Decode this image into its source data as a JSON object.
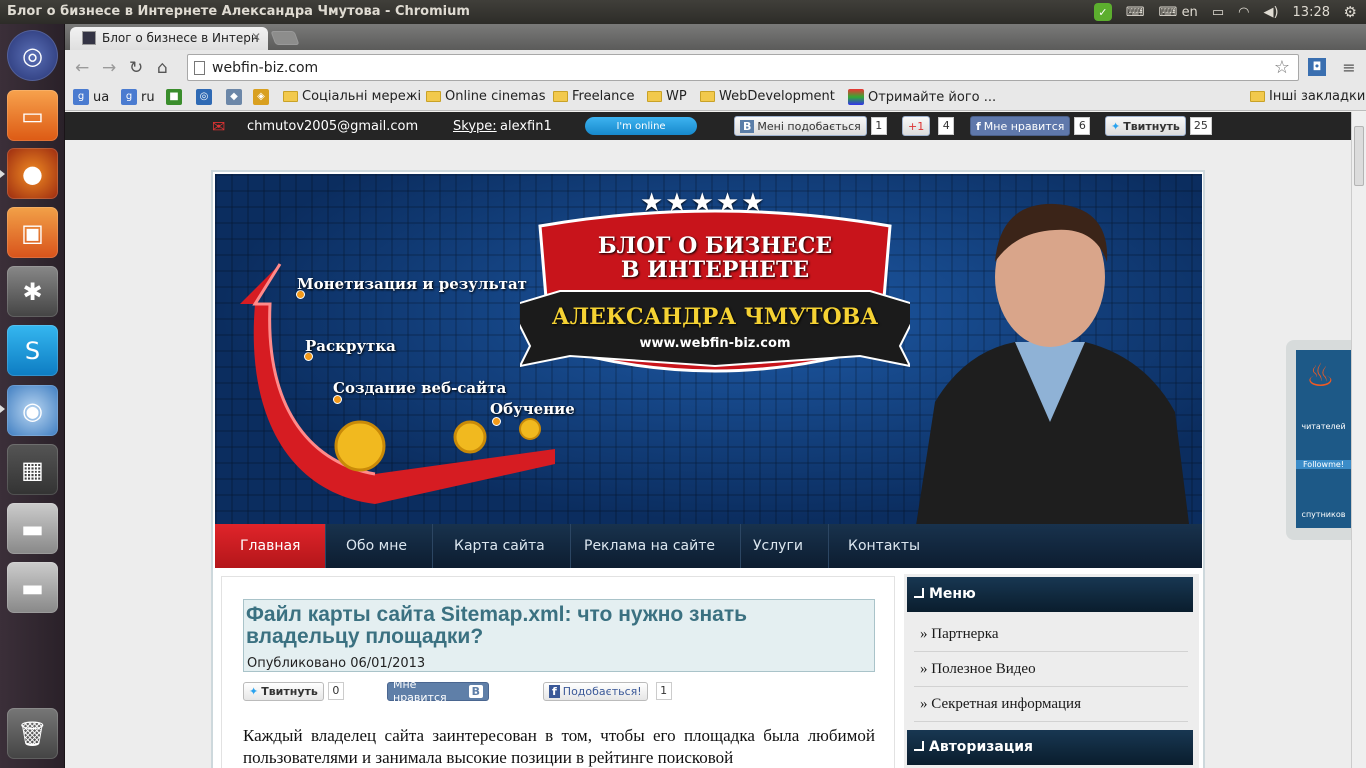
{
  "window": {
    "title": "Блог о бизнесе в Интернете Александра Чмутова - Chromium"
  },
  "system_tray": {
    "keyboard_layout": "en",
    "clock": "13:28"
  },
  "browser": {
    "tab_title": "Блог о бизнесе в Интерн",
    "url": "webfin-biz.com",
    "bookmarks": [
      "ua",
      "ru",
      "Соціальні мережі",
      "Online cinemas",
      "Freelance",
      "WP",
      "WebDevelopment",
      "Отримайте його ...",
      "Інші закладки"
    ]
  },
  "social_bar": {
    "email": "chmutov2005@gmail.com",
    "skype_label": "Skype:",
    "skype_user": "alexfin1",
    "online_status": "I'm online",
    "vk_like": "Мені подобається",
    "vk_count": "1",
    "gplus": "+1",
    "gplus_count": "4",
    "fb_like": "Мне нравится",
    "fb_count": "6",
    "tweet": "Твитнуть",
    "tweet_count": "25"
  },
  "header": {
    "banner_line1": "БЛОГ О БИЗНЕСЕ",
    "banner_line2": "В ИНТЕРНЕТЕ",
    "banner_name": "АЛЕКСАНДРА ЧМУТОВА",
    "banner_url": "www.webfin-biz.com",
    "stages": [
      "Монетизация и результат",
      "Раскрутка",
      "Создание веб-сайта",
      "Обучение"
    ]
  },
  "nav": [
    "Главная",
    "Обо мне",
    "Карта сайта",
    "Реклама на сайте",
    "Услуги",
    "Контакты"
  ],
  "post": {
    "title": "Файл карты сайта Sitemap.xml: что нужно знать владельцу площадки?",
    "date": "Опубликовано 06/01/2013",
    "tweet": "Твитнуть",
    "tweet_count": "0",
    "vk_like": "Мне нравится",
    "vk_badge": "B",
    "fb_like": "Подобається!",
    "fb_count": "1",
    "body": "Каждый владелец сайта заинтересован в том, чтобы его площадка была любимой пользователями и занимала высокие позиции в рейтинге поисковой"
  },
  "sidebar": {
    "menu_title": "Меню",
    "menu_items": [
      "Партнерка",
      "Полезное Видео",
      "Секретная информация"
    ],
    "auth_title": "Авторизация"
  },
  "widget": {
    "readers": "читателей",
    "followme": "Followme!",
    "satellites": "спутников"
  }
}
